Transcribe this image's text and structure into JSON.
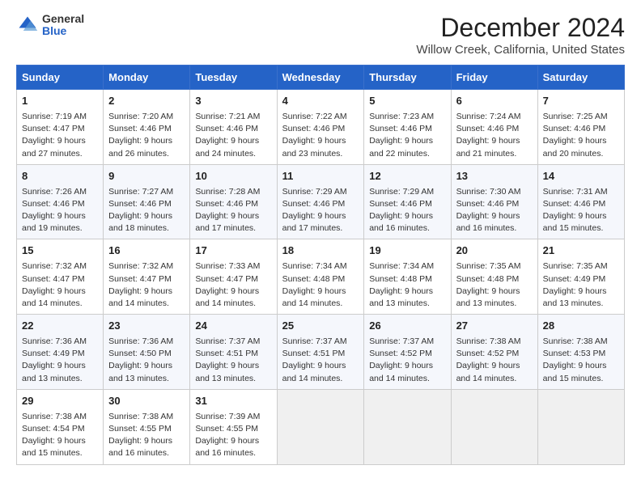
{
  "header": {
    "logo_general": "General",
    "logo_blue": "Blue",
    "month_title": "December 2024",
    "location": "Willow Creek, California, United States"
  },
  "weekdays": [
    "Sunday",
    "Monday",
    "Tuesday",
    "Wednesday",
    "Thursday",
    "Friday",
    "Saturday"
  ],
  "weeks": [
    [
      {
        "day": "1",
        "lines": [
          "Sunrise: 7:19 AM",
          "Sunset: 4:47 PM",
          "Daylight: 9 hours",
          "and 27 minutes."
        ]
      },
      {
        "day": "2",
        "lines": [
          "Sunrise: 7:20 AM",
          "Sunset: 4:46 PM",
          "Daylight: 9 hours",
          "and 26 minutes."
        ]
      },
      {
        "day": "3",
        "lines": [
          "Sunrise: 7:21 AM",
          "Sunset: 4:46 PM",
          "Daylight: 9 hours",
          "and 24 minutes."
        ]
      },
      {
        "day": "4",
        "lines": [
          "Sunrise: 7:22 AM",
          "Sunset: 4:46 PM",
          "Daylight: 9 hours",
          "and 23 minutes."
        ]
      },
      {
        "day": "5",
        "lines": [
          "Sunrise: 7:23 AM",
          "Sunset: 4:46 PM",
          "Daylight: 9 hours",
          "and 22 minutes."
        ]
      },
      {
        "day": "6",
        "lines": [
          "Sunrise: 7:24 AM",
          "Sunset: 4:46 PM",
          "Daylight: 9 hours",
          "and 21 minutes."
        ]
      },
      {
        "day": "7",
        "lines": [
          "Sunrise: 7:25 AM",
          "Sunset: 4:46 PM",
          "Daylight: 9 hours",
          "and 20 minutes."
        ]
      }
    ],
    [
      {
        "day": "8",
        "lines": [
          "Sunrise: 7:26 AM",
          "Sunset: 4:46 PM",
          "Daylight: 9 hours",
          "and 19 minutes."
        ]
      },
      {
        "day": "9",
        "lines": [
          "Sunrise: 7:27 AM",
          "Sunset: 4:46 PM",
          "Daylight: 9 hours",
          "and 18 minutes."
        ]
      },
      {
        "day": "10",
        "lines": [
          "Sunrise: 7:28 AM",
          "Sunset: 4:46 PM",
          "Daylight: 9 hours",
          "and 17 minutes."
        ]
      },
      {
        "day": "11",
        "lines": [
          "Sunrise: 7:29 AM",
          "Sunset: 4:46 PM",
          "Daylight: 9 hours",
          "and 17 minutes."
        ]
      },
      {
        "day": "12",
        "lines": [
          "Sunrise: 7:29 AM",
          "Sunset: 4:46 PM",
          "Daylight: 9 hours",
          "and 16 minutes."
        ]
      },
      {
        "day": "13",
        "lines": [
          "Sunrise: 7:30 AM",
          "Sunset: 4:46 PM",
          "Daylight: 9 hours",
          "and 16 minutes."
        ]
      },
      {
        "day": "14",
        "lines": [
          "Sunrise: 7:31 AM",
          "Sunset: 4:46 PM",
          "Daylight: 9 hours",
          "and 15 minutes."
        ]
      }
    ],
    [
      {
        "day": "15",
        "lines": [
          "Sunrise: 7:32 AM",
          "Sunset: 4:47 PM",
          "Daylight: 9 hours",
          "and 14 minutes."
        ]
      },
      {
        "day": "16",
        "lines": [
          "Sunrise: 7:32 AM",
          "Sunset: 4:47 PM",
          "Daylight: 9 hours",
          "and 14 minutes."
        ]
      },
      {
        "day": "17",
        "lines": [
          "Sunrise: 7:33 AM",
          "Sunset: 4:47 PM",
          "Daylight: 9 hours",
          "and 14 minutes."
        ]
      },
      {
        "day": "18",
        "lines": [
          "Sunrise: 7:34 AM",
          "Sunset: 4:48 PM",
          "Daylight: 9 hours",
          "and 14 minutes."
        ]
      },
      {
        "day": "19",
        "lines": [
          "Sunrise: 7:34 AM",
          "Sunset: 4:48 PM",
          "Daylight: 9 hours",
          "and 13 minutes."
        ]
      },
      {
        "day": "20",
        "lines": [
          "Sunrise: 7:35 AM",
          "Sunset: 4:48 PM",
          "Daylight: 9 hours",
          "and 13 minutes."
        ]
      },
      {
        "day": "21",
        "lines": [
          "Sunrise: 7:35 AM",
          "Sunset: 4:49 PM",
          "Daylight: 9 hours",
          "and 13 minutes."
        ]
      }
    ],
    [
      {
        "day": "22",
        "lines": [
          "Sunrise: 7:36 AM",
          "Sunset: 4:49 PM",
          "Daylight: 9 hours",
          "and 13 minutes."
        ]
      },
      {
        "day": "23",
        "lines": [
          "Sunrise: 7:36 AM",
          "Sunset: 4:50 PM",
          "Daylight: 9 hours",
          "and 13 minutes."
        ]
      },
      {
        "day": "24",
        "lines": [
          "Sunrise: 7:37 AM",
          "Sunset: 4:51 PM",
          "Daylight: 9 hours",
          "and 13 minutes."
        ]
      },
      {
        "day": "25",
        "lines": [
          "Sunrise: 7:37 AM",
          "Sunset: 4:51 PM",
          "Daylight: 9 hours",
          "and 14 minutes."
        ]
      },
      {
        "day": "26",
        "lines": [
          "Sunrise: 7:37 AM",
          "Sunset: 4:52 PM",
          "Daylight: 9 hours",
          "and 14 minutes."
        ]
      },
      {
        "day": "27",
        "lines": [
          "Sunrise: 7:38 AM",
          "Sunset: 4:52 PM",
          "Daylight: 9 hours",
          "and 14 minutes."
        ]
      },
      {
        "day": "28",
        "lines": [
          "Sunrise: 7:38 AM",
          "Sunset: 4:53 PM",
          "Daylight: 9 hours",
          "and 15 minutes."
        ]
      }
    ],
    [
      {
        "day": "29",
        "lines": [
          "Sunrise: 7:38 AM",
          "Sunset: 4:54 PM",
          "Daylight: 9 hours",
          "and 15 minutes."
        ]
      },
      {
        "day": "30",
        "lines": [
          "Sunrise: 7:38 AM",
          "Sunset: 4:55 PM",
          "Daylight: 9 hours",
          "and 16 minutes."
        ]
      },
      {
        "day": "31",
        "lines": [
          "Sunrise: 7:39 AM",
          "Sunset: 4:55 PM",
          "Daylight: 9 hours",
          "and 16 minutes."
        ]
      },
      null,
      null,
      null,
      null
    ]
  ]
}
